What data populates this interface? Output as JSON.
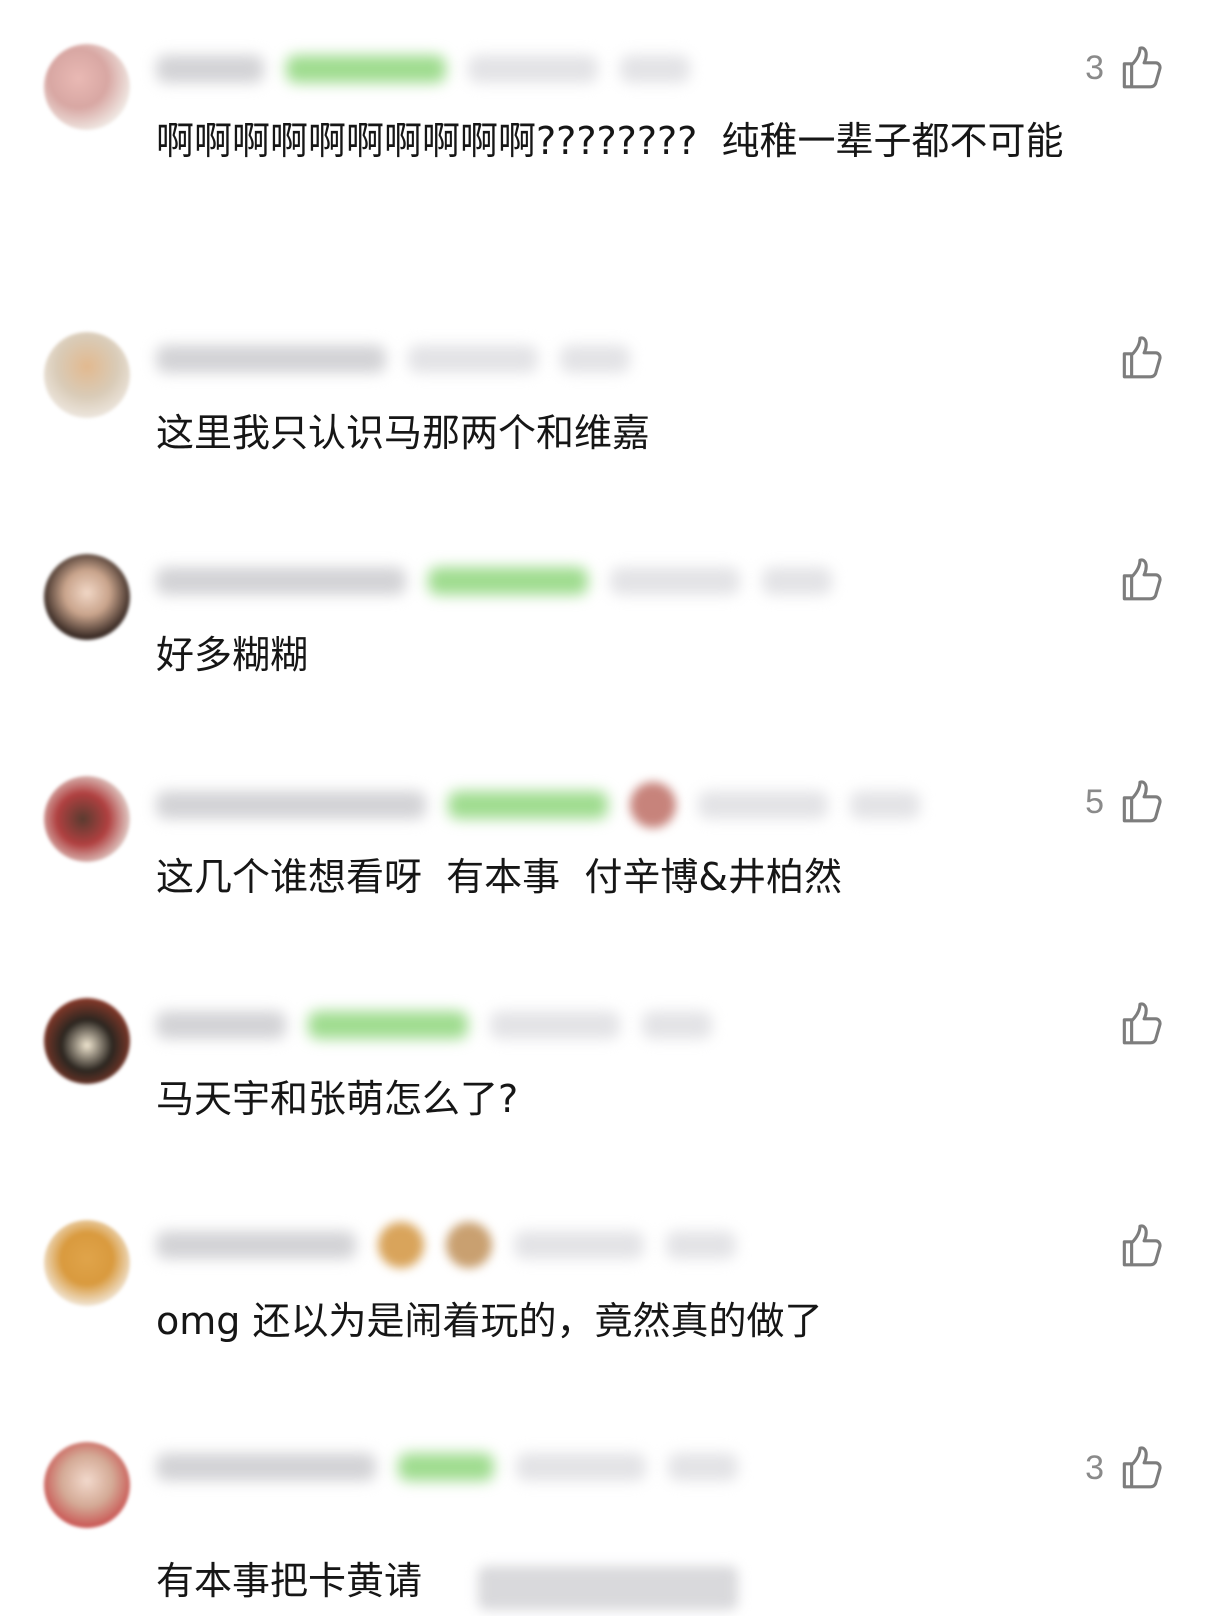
{
  "colors": {
    "text": "#161616",
    "like_count": "#8a8a8a",
    "like_icon": "#7d7d7d",
    "badge_green": "#9fdc8f"
  },
  "icons": {
    "like": "thumbs-up-icon"
  },
  "comments": [
    {
      "likes": "3",
      "text": "啊啊啊啊啊啊啊啊啊啊????????  纯稚一辈子都不可能"
    },
    {
      "likes": "",
      "text": "这里我只认识马那两个和维嘉"
    },
    {
      "likes": "",
      "text": "好多糊糊"
    },
    {
      "likes": "5",
      "text": "这几个谁想看呀  有本事  付辛博&井柏然"
    },
    {
      "likes": "",
      "text": "马天宇和张萌怎么了?"
    },
    {
      "likes": "",
      "text": "omg 还以为是闹着玩的，竟然真的做了"
    },
    {
      "likes": "3",
      "text": "有本事把卡黄请"
    }
  ]
}
